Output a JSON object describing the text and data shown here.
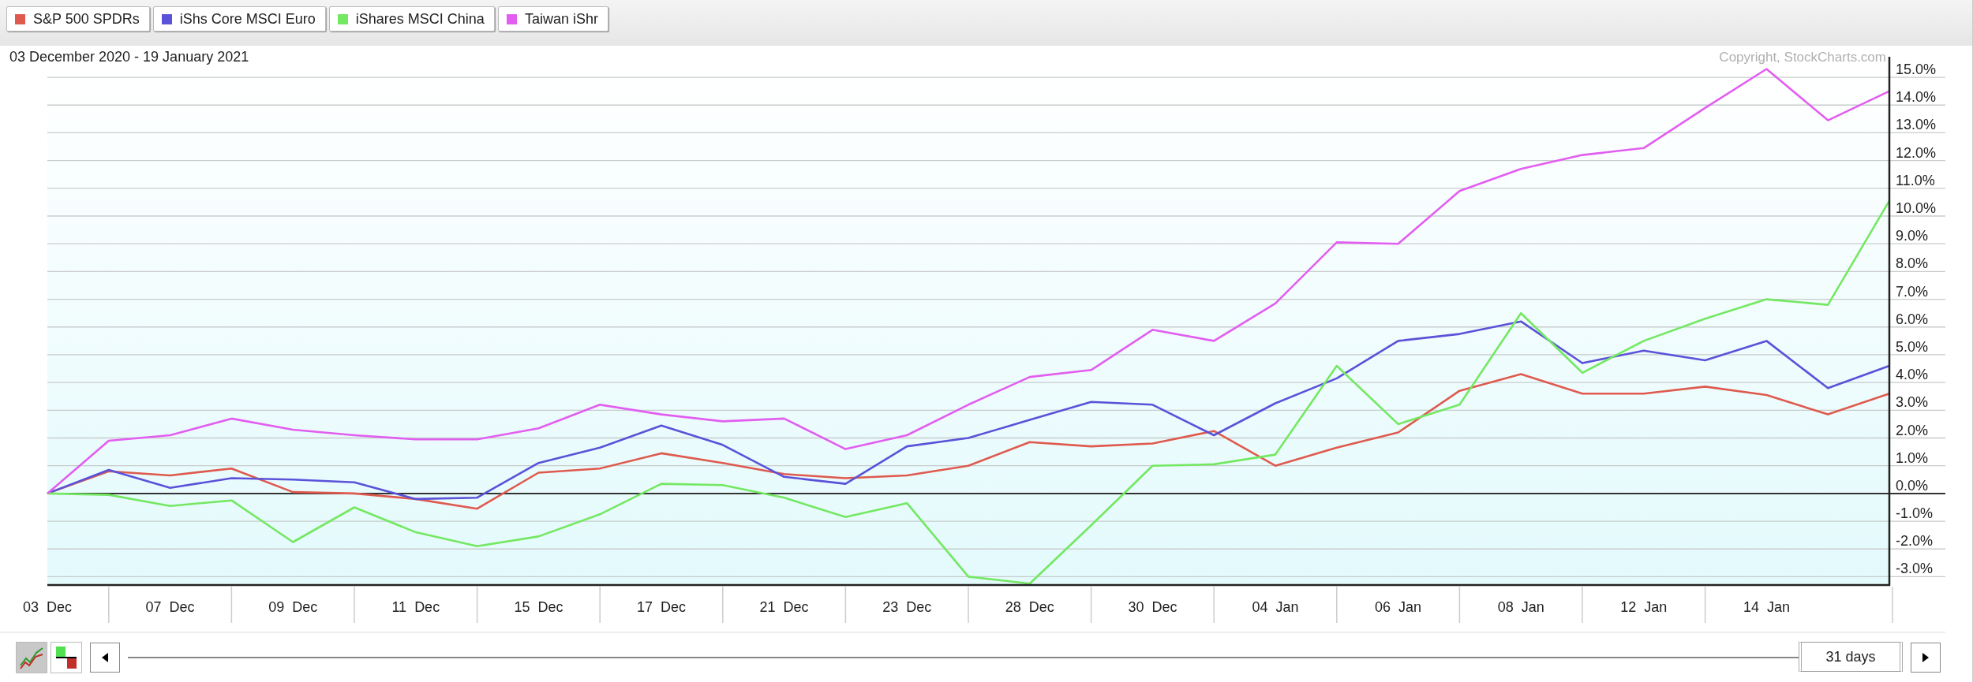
{
  "chart": {
    "copyright": "Copyright, StockCharts.com",
    "chart_data": {
      "type": "line",
      "title": "03 December 2020 - 19 January 2021",
      "categories": [
        "03  Dec",
        null,
        "07  Dec",
        null,
        "09  Dec",
        null,
        "11  Dec",
        null,
        "15  Dec",
        null,
        "17  Dec",
        null,
        "21  Dec",
        null,
        "23  Dec",
        null,
        "28  Dec",
        null,
        "30  Dec",
        null,
        "04  Jan",
        null,
        "06  Jan",
        null,
        "08  Jan",
        null,
        "12  Jan",
        null,
        "14  Jan",
        null,
        null
      ],
      "series": [
        {
          "name": "S&P 500 SPDRs",
          "color": "#df5a4e",
          "values": [
            0,
            0.8,
            0.65,
            0.9,
            0.05,
            0,
            -0.2,
            -0.55,
            0.75,
            0.9,
            1.45,
            1.1,
            0.7,
            0.55,
            0.65,
            1.0,
            1.85,
            1.7,
            1.8,
            2.25,
            1.0,
            1.65,
            2.2,
            3.7,
            4.3,
            3.6,
            3.6,
            3.85,
            3.55,
            2.85,
            3.6
          ]
        },
        {
          "name": "iShs Core MSCI Euro",
          "color": "#5a52d8",
          "values": [
            0,
            0.85,
            0.2,
            0.55,
            0.5,
            0.4,
            -0.2,
            -0.15,
            1.1,
            1.65,
            2.45,
            1.75,
            0.6,
            0.35,
            1.7,
            2.0,
            2.65,
            3.3,
            3.2,
            2.1,
            3.25,
            4.15,
            5.5,
            5.75,
            6.2,
            4.7,
            5.15,
            4.8,
            5.5,
            3.8,
            4.6
          ]
        },
        {
          "name": "iShares MSCI China",
          "color": "#74e862",
          "values": [
            0,
            -0.05,
            -0.45,
            -0.25,
            -1.75,
            -0.5,
            -1.4,
            -1.9,
            -1.55,
            -0.75,
            0.35,
            0.3,
            -0.15,
            -0.85,
            -0.35,
            -3.0,
            -3.25,
            -1.15,
            1.0,
            1.05,
            1.4,
            4.6,
            2.5,
            3.2,
            6.5,
            4.35,
            5.5,
            6.3,
            7.0,
            6.8,
            10.55
          ]
        },
        {
          "name": "Taiwan iShr",
          "color": "#e25ef0",
          "values": [
            0,
            1.9,
            2.1,
            2.7,
            2.3,
            2.1,
            1.95,
            1.95,
            2.35,
            3.2,
            2.85,
            2.6,
            2.7,
            1.6,
            2.1,
            3.2,
            4.2,
            4.45,
            5.9,
            5.5,
            6.85,
            9.05,
            9.0,
            10.9,
            11.7,
            12.2,
            12.45,
            13.9,
            15.3,
            13.45,
            14.5
          ]
        }
      ],
      "ylim": [
        -3.3,
        15.4
      ],
      "grid": true,
      "yticks": [
        {
          "value": 15,
          "label": "15.0%"
        },
        {
          "value": 14,
          "label": "14.0%"
        },
        {
          "value": 13,
          "label": "13.0%"
        },
        {
          "value": 12,
          "label": "12.0%"
        },
        {
          "value": 11,
          "label": "11.0%"
        },
        {
          "value": 10,
          "label": "10.0%"
        },
        {
          "value": 9,
          "label": "9.0%"
        },
        {
          "value": 8,
          "label": "8.0%"
        },
        {
          "value": 7,
          "label": "7.0%"
        },
        {
          "value": 6,
          "label": "6.0%"
        },
        {
          "value": 5,
          "label": "5.0%"
        },
        {
          "value": 4,
          "label": "4.0%"
        },
        {
          "value": 3,
          "label": "3.0%"
        },
        {
          "value": 2,
          "label": "2.0%"
        },
        {
          "value": 1,
          "label": "1.0%"
        },
        {
          "value": 0,
          "label": "0.0%"
        },
        {
          "value": -1,
          "label": "-1.0%"
        },
        {
          "value": -2,
          "label": "-2.0%"
        },
        {
          "value": -3,
          "label": "-3.0%"
        }
      ]
    }
  },
  "controls": {
    "view_buttons": [
      {
        "kind": "line",
        "selected": true
      },
      {
        "kind": "bars",
        "selected": false
      }
    ],
    "scroller": {
      "label": "31 days",
      "level": 1
    }
  }
}
